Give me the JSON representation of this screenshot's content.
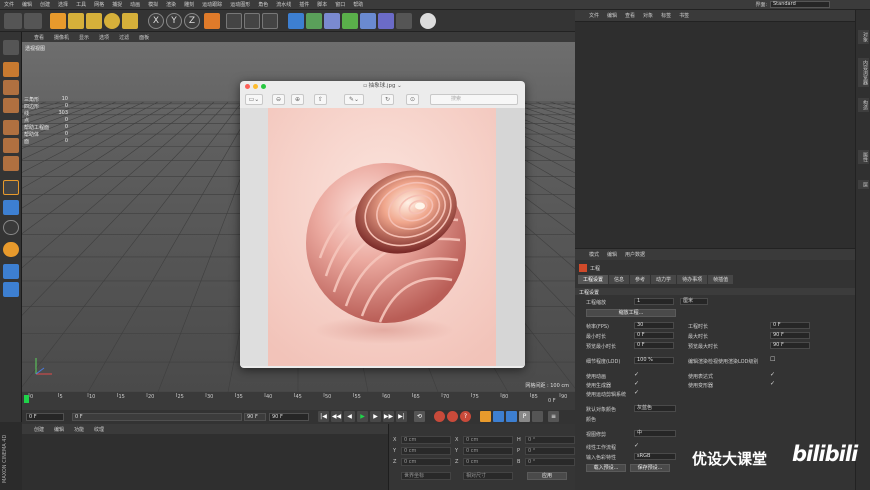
{
  "menubar": {
    "items": [
      "文件",
      "编辑",
      "创建",
      "选择",
      "工具",
      "网格",
      "捕捉",
      "动画",
      "模拟",
      "渲染",
      "雕刻",
      "运动跟踪",
      "运动图形",
      "角色",
      "流水线",
      "插件",
      "脚本",
      "窗口",
      "帮助"
    ],
    "layout_label": "界面:",
    "layout_value": "Standard"
  },
  "viewport": {
    "menu": [
      "查看",
      "摄像机",
      "显示",
      "选项",
      "过滤",
      "面板"
    ],
    "camera_label": "透视视图",
    "grid_spacing": "网格间距 : 100 cm"
  },
  "hud": [
    {
      "label": "三角形",
      "value": "10"
    },
    {
      "label": "四边形",
      "value": "0"
    },
    {
      "label": "线",
      "value": "303"
    },
    {
      "label": "点",
      "value": "0"
    },
    {
      "label": "帮助工程面",
      "value": "0"
    },
    {
      "label": "帮助体",
      "value": "0"
    },
    {
      "label": "面",
      "value": "0"
    }
  ],
  "timeline": {
    "ticks": [
      "0",
      "5",
      "10",
      "15",
      "20",
      "25",
      "30",
      "35",
      "40",
      "45",
      "50",
      "55",
      "60",
      "65",
      "70",
      "75",
      "80",
      "85",
      "90"
    ],
    "frame_indicator": "0 F",
    "start_field": "0 F",
    "current_field": "0 F",
    "end_field": "90 F",
    "end_field2": "90 F"
  },
  "material_menu": [
    "创建",
    "编辑",
    "功能",
    "纹理"
  ],
  "coords": {
    "rows": [
      {
        "a": "X",
        "av": "0 cm",
        "b": "X",
        "bv": "0 cm",
        "c": "H",
        "cv": "0 °"
      },
      {
        "a": "Y",
        "av": "0 cm",
        "b": "Y",
        "bv": "0 cm",
        "c": "P",
        "cv": "0 °"
      },
      {
        "a": "Z",
        "av": "0 cm",
        "b": "Z",
        "bv": "0 cm",
        "c": "B",
        "cv": "0 °"
      }
    ],
    "mode1": "世界坐标",
    "mode2": "相对尺寸",
    "apply": "应用"
  },
  "object_manager": {
    "menu": [
      "文件",
      "编辑",
      "查看",
      "对象",
      "标签",
      "书签"
    ]
  },
  "attribute_manager": {
    "menu": [
      "模式",
      "编辑",
      "用户数据"
    ],
    "title": "工程",
    "tabs": [
      "工程设置",
      "信息",
      "参考",
      "动力学",
      "待办事项",
      "帧插值"
    ],
    "section": "工程设置",
    "scale_label": "工程缩放",
    "scale_value": "1",
    "scale_unit": "厘米",
    "scale_btn": "缩放工程...",
    "fps_label": "帧率(FPS)",
    "fps_value": "30",
    "project_time_label": "工程时长",
    "project_time_value": "0 F",
    "min_time_label": "最小时长",
    "min_time_value": "0 F",
    "max_time_label": "最大时长",
    "max_time_value": "90 F",
    "preview_min_label": "预览最小时长",
    "preview_min_value": "0 F",
    "preview_max_label": "预览最大时长",
    "preview_max_value": "90 F",
    "lod_label": "细节程度(LOD)",
    "lod_value": "100 %",
    "lod_render_label": "编辑渲染检视使用渲染LOD级别",
    "use_anim": "使用动画",
    "use_expr": "使用表达式",
    "use_gen": "使用生成器",
    "use_deform": "使用变形器",
    "use_motion": "使用运动剪辑系统",
    "default_color_label": "默认对象颜色",
    "default_color_value": "灰蓝色",
    "color_label": "颜色",
    "view_clip_label": "视图修剪",
    "view_clip_value": "中",
    "linear_label": "线性工作流程",
    "input_color_label": "输入色彩特性",
    "input_color_value": "sRGB",
    "load_preset": "载入预设...",
    "save_preset": "保存预设..."
  },
  "right_tabs": [
    "对象",
    "内容浏览器",
    "构造",
    "属性",
    "层"
  ],
  "preview_window": {
    "title": "▫ 抽象球.jpg ⌄",
    "search": "搜索"
  },
  "watermark": {
    "brand": "优设大课堂",
    "bili": "bilibili"
  },
  "maxon": "MAXON CINEMA 4D",
  "colors": {
    "accent_orange": "#e89a2c",
    "accent_blue": "#3d7fd1",
    "play_green": "#1fd44a",
    "sphere_pink": "#e8a59d"
  }
}
